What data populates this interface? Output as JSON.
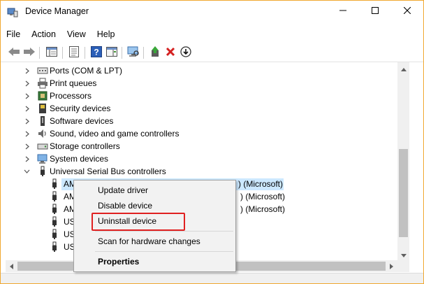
{
  "window": {
    "title": "Device Manager"
  },
  "menubar": {
    "items": [
      "File",
      "Action",
      "View",
      "Help"
    ]
  },
  "tree": {
    "categories": [
      {
        "label": "Ports (COM & LPT)",
        "icon": "port-icon",
        "expanded": false
      },
      {
        "label": "Print queues",
        "icon": "printer-icon",
        "expanded": false
      },
      {
        "label": "Processors",
        "icon": "processor-icon",
        "expanded": false
      },
      {
        "label": "Security devices",
        "icon": "security-icon",
        "expanded": false
      },
      {
        "label": "Software devices",
        "icon": "software-icon",
        "expanded": false
      },
      {
        "label": "Sound, video and game controllers",
        "icon": "speaker-icon",
        "expanded": false
      },
      {
        "label": "Storage controllers",
        "icon": "storage-icon",
        "expanded": false
      },
      {
        "label": "System devices",
        "icon": "system-icon",
        "expanded": false
      },
      {
        "label": "Universal Serial Bus controllers",
        "icon": "usb-icon",
        "expanded": true
      }
    ],
    "usb_children": [
      {
        "prefix": "AM",
        "suffix": ") (Microsoft)"
      },
      {
        "prefix": "AM",
        "suffix": ") (Microsoft)"
      },
      {
        "prefix": "AM",
        "suffix": ") (Microsoft)"
      },
      {
        "prefix": "US",
        "suffix": ""
      },
      {
        "prefix": "US",
        "suffix": ""
      },
      {
        "prefix": "US",
        "suffix": ""
      }
    ]
  },
  "context_menu": {
    "update_driver": "Update driver",
    "disable_device": "Disable device",
    "uninstall_device": "Uninstall device",
    "scan_changes": "Scan for hardware changes",
    "properties": "Properties"
  },
  "colors": {
    "selection": "#cce8ff",
    "highlight_box": "#e02020",
    "window_border": "#f0a830"
  }
}
